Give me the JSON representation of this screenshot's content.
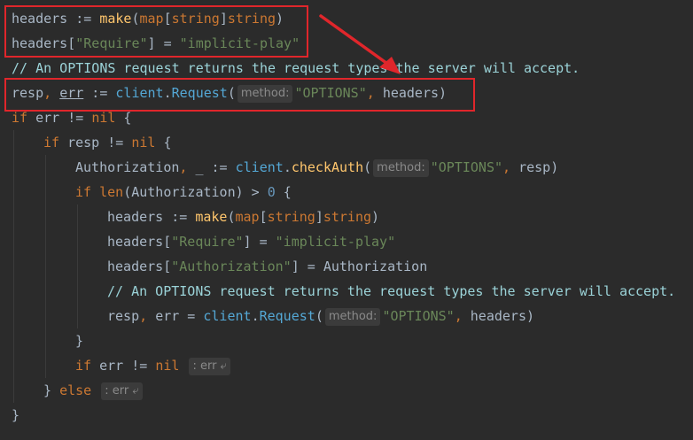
{
  "accent_color": "#e0262b",
  "lines": [
    {
      "indent": 0,
      "tokens": [
        {
          "t": "headers",
          "c": "id"
        },
        {
          "t": " := ",
          "c": "punc"
        },
        {
          "t": "make",
          "c": "fn"
        },
        {
          "t": "(",
          "c": "punc"
        },
        {
          "t": "map",
          "c": "kw"
        },
        {
          "t": "[",
          "c": "punc"
        },
        {
          "t": "string",
          "c": "kw"
        },
        {
          "t": "]",
          "c": "punc"
        },
        {
          "t": "string",
          "c": "kw"
        },
        {
          "t": ")",
          "c": "punc"
        }
      ]
    },
    {
      "indent": 0,
      "tokens": [
        {
          "t": "headers",
          "c": "id"
        },
        {
          "t": "[",
          "c": "punc"
        },
        {
          "t": "\"Require\"",
          "c": "str"
        },
        {
          "t": "] = ",
          "c": "punc"
        },
        {
          "t": "\"implicit-play\"",
          "c": "str"
        }
      ]
    },
    {
      "indent": 0,
      "tokens": [
        {
          "t": "// An OPTIONS request returns the request types the server will accept.",
          "c": "cm"
        }
      ]
    },
    {
      "indent": 0,
      "tokens": [
        {
          "t": "resp",
          "c": "id"
        },
        {
          "t": ", ",
          "c": "kw"
        },
        {
          "t": "err",
          "c": "id",
          "u": true
        },
        {
          "t": " := ",
          "c": "punc"
        },
        {
          "t": "client",
          "c": "call"
        },
        {
          "t": ".",
          "c": "punc"
        },
        {
          "t": "Request",
          "c": "call"
        },
        {
          "t": "(",
          "c": "punc"
        },
        {
          "hint": "method:"
        },
        {
          "t": "\"OPTIONS\"",
          "c": "str"
        },
        {
          "t": ", ",
          "c": "kw"
        },
        {
          "t": "headers",
          "c": "id"
        },
        {
          "t": ")",
          "c": "punc"
        }
      ]
    },
    {
      "indent": 0,
      "tokens": [
        {
          "t": "if",
          "c": "kw"
        },
        {
          "t": " err != ",
          "c": "id"
        },
        {
          "t": "nil",
          "c": "kw"
        },
        {
          "t": " {",
          "c": "punc"
        }
      ]
    },
    {
      "indent": 1,
      "tokens": [
        {
          "t": "if",
          "c": "kw"
        },
        {
          "t": " resp != ",
          "c": "id"
        },
        {
          "t": "nil",
          "c": "kw"
        },
        {
          "t": " {",
          "c": "punc"
        }
      ]
    },
    {
      "indent": 2,
      "tokens": [
        {
          "t": "Authorization",
          "c": "id"
        },
        {
          "t": ", ",
          "c": "kw"
        },
        {
          "t": "_ := ",
          "c": "id"
        },
        {
          "t": "client",
          "c": "call"
        },
        {
          "t": ".",
          "c": "punc"
        },
        {
          "t": "checkAuth",
          "c": "fn"
        },
        {
          "t": "(",
          "c": "punc"
        },
        {
          "hint": "method:"
        },
        {
          "t": "\"OPTIONS\"",
          "c": "str"
        },
        {
          "t": ", ",
          "c": "kw"
        },
        {
          "t": "resp",
          "c": "id"
        },
        {
          "t": ")",
          "c": "punc"
        }
      ]
    },
    {
      "indent": 2,
      "tokens": [
        {
          "t": "if",
          "c": "kw"
        },
        {
          "t": " ",
          "c": "id"
        },
        {
          "t": "len",
          "c": "kw"
        },
        {
          "t": "(Authorization) > ",
          "c": "id"
        },
        {
          "t": "0",
          "c": "num"
        },
        {
          "t": " {",
          "c": "punc"
        }
      ]
    },
    {
      "indent": 3,
      "tokens": [
        {
          "t": "headers",
          "c": "id"
        },
        {
          "t": " := ",
          "c": "punc"
        },
        {
          "t": "make",
          "c": "fn"
        },
        {
          "t": "(",
          "c": "punc"
        },
        {
          "t": "map",
          "c": "kw"
        },
        {
          "t": "[",
          "c": "punc"
        },
        {
          "t": "string",
          "c": "kw"
        },
        {
          "t": "]",
          "c": "punc"
        },
        {
          "t": "string",
          "c": "kw"
        },
        {
          "t": ")",
          "c": "punc"
        }
      ]
    },
    {
      "indent": 3,
      "tokens": [
        {
          "t": "headers",
          "c": "id"
        },
        {
          "t": "[",
          "c": "punc"
        },
        {
          "t": "\"Require\"",
          "c": "str"
        },
        {
          "t": "] = ",
          "c": "punc"
        },
        {
          "t": "\"implicit-play\"",
          "c": "str"
        }
      ]
    },
    {
      "indent": 3,
      "tokens": [
        {
          "t": "headers",
          "c": "id"
        },
        {
          "t": "[",
          "c": "punc"
        },
        {
          "t": "\"Authorization\"",
          "c": "str"
        },
        {
          "t": "] = Authorization",
          "c": "punc"
        }
      ]
    },
    {
      "indent": 3,
      "tokens": [
        {
          "t": "// An OPTIONS request returns the request types the server will accept.",
          "c": "cm"
        }
      ]
    },
    {
      "indent": 3,
      "tokens": [
        {
          "t": "resp",
          "c": "id"
        },
        {
          "t": ", ",
          "c": "kw"
        },
        {
          "t": "err = ",
          "c": "id"
        },
        {
          "t": "client",
          "c": "call"
        },
        {
          "t": ".",
          "c": "punc"
        },
        {
          "t": "Request",
          "c": "call"
        },
        {
          "t": "(",
          "c": "punc"
        },
        {
          "hint": "method:"
        },
        {
          "t": "\"OPTIONS\"",
          "c": "str"
        },
        {
          "t": ", ",
          "c": "kw"
        },
        {
          "t": "headers",
          "c": "id"
        },
        {
          "t": ")",
          "c": "punc"
        }
      ]
    },
    {
      "indent": 2,
      "tokens": [
        {
          "t": "}",
          "c": "punc"
        }
      ]
    },
    {
      "indent": 2,
      "tokens": [
        {
          "t": "if",
          "c": "kw"
        },
        {
          "t": " err != ",
          "c": "id"
        },
        {
          "t": "nil",
          "c": "kw"
        },
        {
          "t": " ",
          "c": "id"
        },
        {
          "hint": ": err ⤶"
        }
      ]
    },
    {
      "indent": 1,
      "tokens": [
        {
          "t": "} ",
          "c": "punc"
        },
        {
          "t": "else",
          "c": "kw"
        },
        {
          "t": " ",
          "c": "id"
        },
        {
          "hint": ": err ⤶"
        }
      ]
    },
    {
      "indent": 0,
      "tokens": [
        {
          "t": "}",
          "c": "punc"
        }
      ]
    }
  ]
}
